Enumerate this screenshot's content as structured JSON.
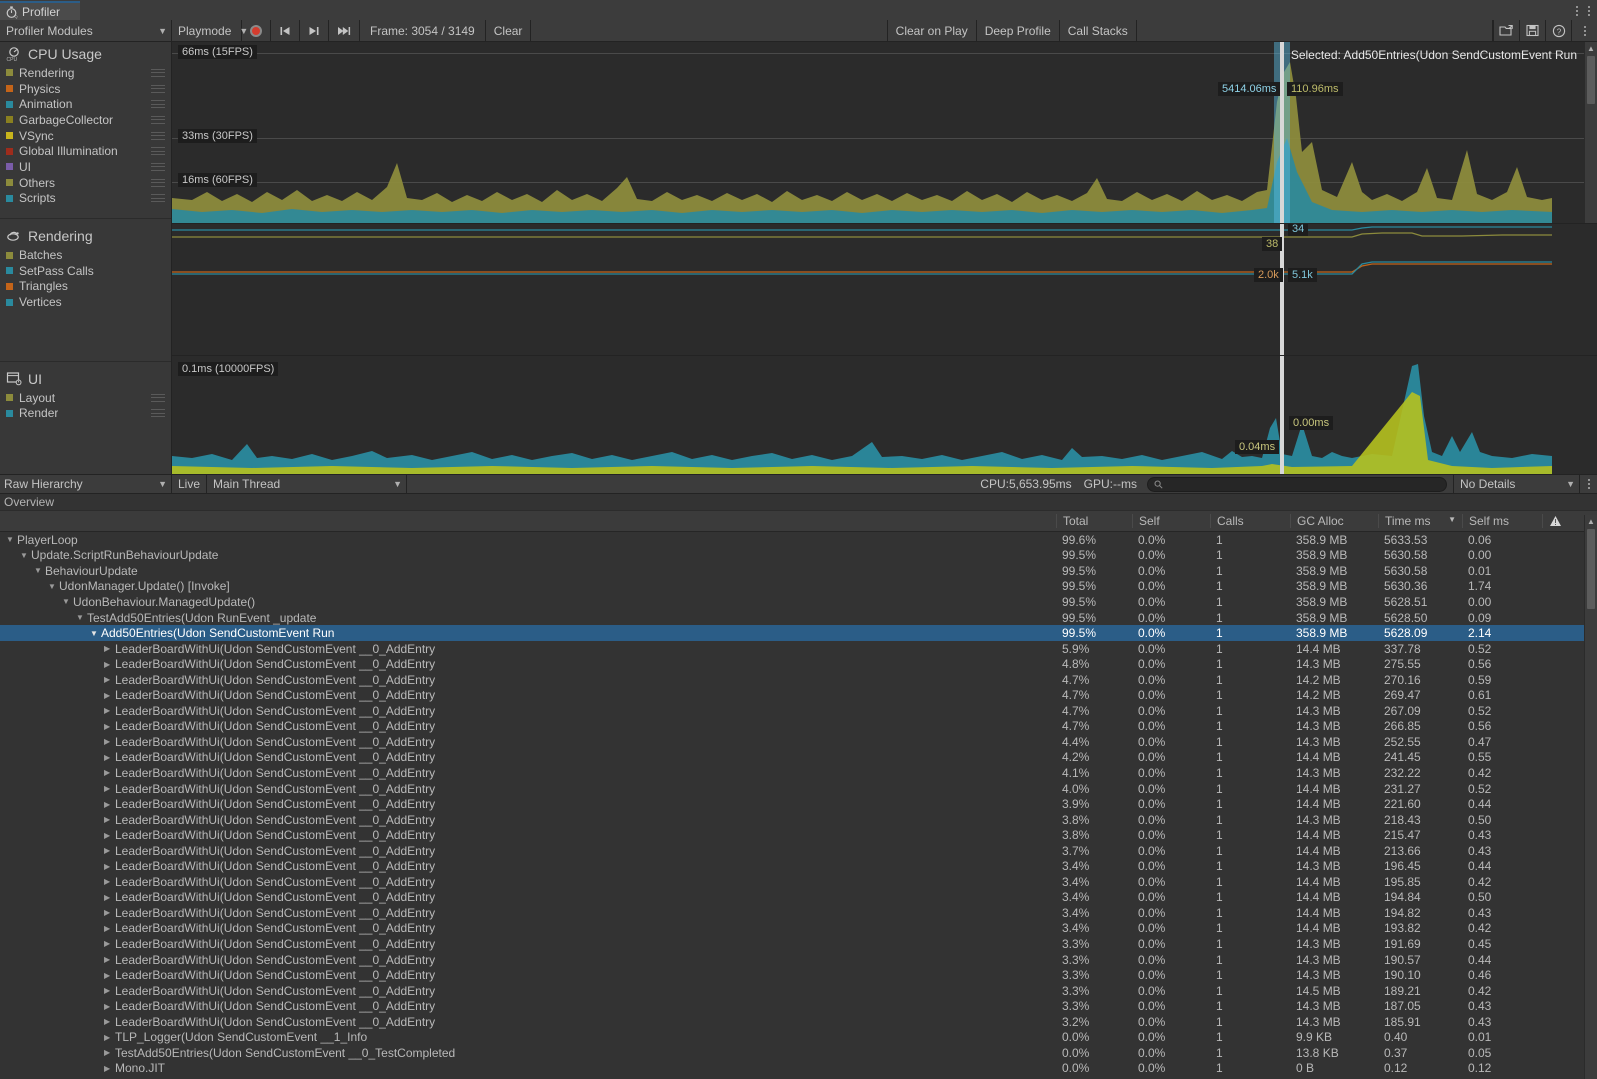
{
  "window": {
    "tab_title": "Profiler",
    "tab_icon": "stopwatch-icon",
    "kebab_icon": "kebab-menu-icon"
  },
  "toolbar": {
    "modules_label": "Profiler Modules",
    "playmode_label": "Playmode",
    "record_icon": "record-icon",
    "first_frame_icon": "skip-to-start-icon",
    "prev_frame_icon": "step-back-icon",
    "last_frame_icon": "skip-to-end-icon",
    "frame_label": "Frame: 3054 / 3149",
    "clear_label": "Clear",
    "clear_on_play_label": "Clear on Play",
    "deep_profile_label": "Deep Profile",
    "call_stacks_label": "Call Stacks",
    "load_icon": "open-folder-icon",
    "save_icon": "save-disk-icon",
    "help_icon": "help-question-icon",
    "menu_icon": "kebab-menu-icon"
  },
  "modules": [
    {
      "title": "CPU Usage",
      "icon": "cpu-icon",
      "items": [
        {
          "label": "Rendering",
          "color": "#8c8b3c"
        },
        {
          "label": "Physics",
          "color": "#c46419"
        },
        {
          "label": "Animation",
          "color": "#2a8a9e"
        },
        {
          "label": "GarbageCollector",
          "color": "#8a8020"
        },
        {
          "label": "VSync",
          "color": "#c8b41c"
        },
        {
          "label": "Global Illumination",
          "color": "#9e2c1c"
        },
        {
          "label": "UI",
          "color": "#7a5ca8"
        },
        {
          "label": "Others",
          "color": "#8c8b3c"
        },
        {
          "label": "Scripts",
          "color": "#2a8a9e"
        }
      ]
    },
    {
      "title": "Rendering",
      "icon": "rendering-icon",
      "items": [
        {
          "label": "Batches",
          "color": "#8c8b3c"
        },
        {
          "label": "SetPass Calls",
          "color": "#2a8a9e"
        },
        {
          "label": "Triangles",
          "color": "#c46419"
        },
        {
          "label": "Vertices",
          "color": "#2a8a9e"
        }
      ]
    },
    {
      "title": "UI",
      "icon": "ui-icon",
      "items": [
        {
          "label": "Layout",
          "color": "#8c8b3c"
        },
        {
          "label": "Render",
          "color": "#2a8a9e"
        }
      ]
    }
  ],
  "charts": {
    "cpu": {
      "gridlines": [
        "66ms (15FPS)",
        "33ms (30FPS)",
        "16ms (60FPS)"
      ],
      "marker_left": "5414.06ms",
      "marker_right": "110.96ms",
      "selected_text": "Selected: Add50Entries(Udon SendCustomEvent Run"
    },
    "rendering": {
      "markers": [
        "34",
        "38",
        "2.0k",
        "5.1k"
      ]
    },
    "ui": {
      "gridlines": [
        "0.1ms (10000FPS)"
      ],
      "markers": [
        "0.00ms",
        "0.04ms"
      ]
    }
  },
  "hierarchy_toolbar": {
    "view_label": "Raw Hierarchy",
    "live_label": "Live",
    "thread_label": "Main Thread",
    "cpu_stat": "CPU:5,653.95ms",
    "gpu_stat": "GPU:--ms",
    "search_placeholder": "",
    "search_value": "",
    "search_icon": "search-icon",
    "details_label": "No Details",
    "kebab_icon": "kebab-menu-icon"
  },
  "table": {
    "overview_label": "Overview",
    "columns": [
      "Total",
      "Self",
      "Calls",
      "GC Alloc",
      "Time ms",
      "Self ms"
    ],
    "warning_icon": "warning-triangle-icon",
    "sorted_column": "Time ms",
    "sort_icon": "sort-descending-icon",
    "rows": [
      {
        "depth": 0,
        "twisty": "open",
        "name": "PlayerLoop",
        "total": "99.6%",
        "self": "0.0%",
        "calls": "1",
        "gc": "358.9 MB",
        "time": "5633.53",
        "selfms": "0.06",
        "selected": false
      },
      {
        "depth": 1,
        "twisty": "open",
        "name": "Update.ScriptRunBehaviourUpdate",
        "total": "99.5%",
        "self": "0.0%",
        "calls": "1",
        "gc": "358.9 MB",
        "time": "5630.58",
        "selfms": "0.00",
        "selected": false
      },
      {
        "depth": 2,
        "twisty": "open",
        "name": "BehaviourUpdate",
        "total": "99.5%",
        "self": "0.0%",
        "calls": "1",
        "gc": "358.9 MB",
        "time": "5630.58",
        "selfms": "0.01",
        "selected": false
      },
      {
        "depth": 3,
        "twisty": "open",
        "name": "UdonManager.Update() [Invoke]",
        "total": "99.5%",
        "self": "0.0%",
        "calls": "1",
        "gc": "358.9 MB",
        "time": "5630.36",
        "selfms": "1.74",
        "selected": false
      },
      {
        "depth": 4,
        "twisty": "open",
        "name": "UdonBehaviour.ManagedUpdate()",
        "total": "99.5%",
        "self": "0.0%",
        "calls": "1",
        "gc": "358.9 MB",
        "time": "5628.51",
        "selfms": "0.00",
        "selected": false
      },
      {
        "depth": 5,
        "twisty": "open",
        "name": "TestAdd50Entries(Udon RunEvent _update",
        "total": "99.5%",
        "self": "0.0%",
        "calls": "1",
        "gc": "358.9 MB",
        "time": "5628.50",
        "selfms": "0.09",
        "selected": false
      },
      {
        "depth": 6,
        "twisty": "open",
        "name": "Add50Entries(Udon SendCustomEvent Run",
        "total": "99.5%",
        "self": "0.0%",
        "calls": "1",
        "gc": "358.9 MB",
        "time": "5628.09",
        "selfms": "2.14",
        "selected": true
      },
      {
        "depth": 7,
        "twisty": "closed",
        "name": "LeaderBoardWithUi(Udon SendCustomEvent __0_AddEntry",
        "total": "5.9%",
        "self": "0.0%",
        "calls": "1",
        "gc": "14.4 MB",
        "time": "337.78",
        "selfms": "0.52",
        "selected": false
      },
      {
        "depth": 7,
        "twisty": "closed",
        "name": "LeaderBoardWithUi(Udon SendCustomEvent __0_AddEntry",
        "total": "4.8%",
        "self": "0.0%",
        "calls": "1",
        "gc": "14.3 MB",
        "time": "275.55",
        "selfms": "0.56",
        "selected": false
      },
      {
        "depth": 7,
        "twisty": "closed",
        "name": "LeaderBoardWithUi(Udon SendCustomEvent __0_AddEntry",
        "total": "4.7%",
        "self": "0.0%",
        "calls": "1",
        "gc": "14.2 MB",
        "time": "270.16",
        "selfms": "0.59",
        "selected": false
      },
      {
        "depth": 7,
        "twisty": "closed",
        "name": "LeaderBoardWithUi(Udon SendCustomEvent __0_AddEntry",
        "total": "4.7%",
        "self": "0.0%",
        "calls": "1",
        "gc": "14.2 MB",
        "time": "269.47",
        "selfms": "0.61",
        "selected": false
      },
      {
        "depth": 7,
        "twisty": "closed",
        "name": "LeaderBoardWithUi(Udon SendCustomEvent __0_AddEntry",
        "total": "4.7%",
        "self": "0.0%",
        "calls": "1",
        "gc": "14.3 MB",
        "time": "267.09",
        "selfms": "0.52",
        "selected": false
      },
      {
        "depth": 7,
        "twisty": "closed",
        "name": "LeaderBoardWithUi(Udon SendCustomEvent __0_AddEntry",
        "total": "4.7%",
        "self": "0.0%",
        "calls": "1",
        "gc": "14.3 MB",
        "time": "266.85",
        "selfms": "0.56",
        "selected": false
      },
      {
        "depth": 7,
        "twisty": "closed",
        "name": "LeaderBoardWithUi(Udon SendCustomEvent __0_AddEntry",
        "total": "4.4%",
        "self": "0.0%",
        "calls": "1",
        "gc": "14.3 MB",
        "time": "252.55",
        "selfms": "0.47",
        "selected": false
      },
      {
        "depth": 7,
        "twisty": "closed",
        "name": "LeaderBoardWithUi(Udon SendCustomEvent __0_AddEntry",
        "total": "4.2%",
        "self": "0.0%",
        "calls": "1",
        "gc": "14.4 MB",
        "time": "241.45",
        "selfms": "0.55",
        "selected": false
      },
      {
        "depth": 7,
        "twisty": "closed",
        "name": "LeaderBoardWithUi(Udon SendCustomEvent __0_AddEntry",
        "total": "4.1%",
        "self": "0.0%",
        "calls": "1",
        "gc": "14.3 MB",
        "time": "232.22",
        "selfms": "0.42",
        "selected": false
      },
      {
        "depth": 7,
        "twisty": "closed",
        "name": "LeaderBoardWithUi(Udon SendCustomEvent __0_AddEntry",
        "total": "4.0%",
        "self": "0.0%",
        "calls": "1",
        "gc": "14.4 MB",
        "time": "231.27",
        "selfms": "0.52",
        "selected": false
      },
      {
        "depth": 7,
        "twisty": "closed",
        "name": "LeaderBoardWithUi(Udon SendCustomEvent __0_AddEntry",
        "total": "3.9%",
        "self": "0.0%",
        "calls": "1",
        "gc": "14.4 MB",
        "time": "221.60",
        "selfms": "0.44",
        "selected": false
      },
      {
        "depth": 7,
        "twisty": "closed",
        "name": "LeaderBoardWithUi(Udon SendCustomEvent __0_AddEntry",
        "total": "3.8%",
        "self": "0.0%",
        "calls": "1",
        "gc": "14.3 MB",
        "time": "218.43",
        "selfms": "0.50",
        "selected": false
      },
      {
        "depth": 7,
        "twisty": "closed",
        "name": "LeaderBoardWithUi(Udon SendCustomEvent __0_AddEntry",
        "total": "3.8%",
        "self": "0.0%",
        "calls": "1",
        "gc": "14.4 MB",
        "time": "215.47",
        "selfms": "0.43",
        "selected": false
      },
      {
        "depth": 7,
        "twisty": "closed",
        "name": "LeaderBoardWithUi(Udon SendCustomEvent __0_AddEntry",
        "total": "3.7%",
        "self": "0.0%",
        "calls": "1",
        "gc": "14.4 MB",
        "time": "213.66",
        "selfms": "0.43",
        "selected": false
      },
      {
        "depth": 7,
        "twisty": "closed",
        "name": "LeaderBoardWithUi(Udon SendCustomEvent __0_AddEntry",
        "total": "3.4%",
        "self": "0.0%",
        "calls": "1",
        "gc": "14.3 MB",
        "time": "196.45",
        "selfms": "0.44",
        "selected": false
      },
      {
        "depth": 7,
        "twisty": "closed",
        "name": "LeaderBoardWithUi(Udon SendCustomEvent __0_AddEntry",
        "total": "3.4%",
        "self": "0.0%",
        "calls": "1",
        "gc": "14.4 MB",
        "time": "195.85",
        "selfms": "0.42",
        "selected": false
      },
      {
        "depth": 7,
        "twisty": "closed",
        "name": "LeaderBoardWithUi(Udon SendCustomEvent __0_AddEntry",
        "total": "3.4%",
        "self": "0.0%",
        "calls": "1",
        "gc": "14.4 MB",
        "time": "194.84",
        "selfms": "0.50",
        "selected": false
      },
      {
        "depth": 7,
        "twisty": "closed",
        "name": "LeaderBoardWithUi(Udon SendCustomEvent __0_AddEntry",
        "total": "3.4%",
        "self": "0.0%",
        "calls": "1",
        "gc": "14.4 MB",
        "time": "194.82",
        "selfms": "0.43",
        "selected": false
      },
      {
        "depth": 7,
        "twisty": "closed",
        "name": "LeaderBoardWithUi(Udon SendCustomEvent __0_AddEntry",
        "total": "3.4%",
        "self": "0.0%",
        "calls": "1",
        "gc": "14.4 MB",
        "time": "193.82",
        "selfms": "0.42",
        "selected": false
      },
      {
        "depth": 7,
        "twisty": "closed",
        "name": "LeaderBoardWithUi(Udon SendCustomEvent __0_AddEntry",
        "total": "3.3%",
        "self": "0.0%",
        "calls": "1",
        "gc": "14.3 MB",
        "time": "191.69",
        "selfms": "0.45",
        "selected": false
      },
      {
        "depth": 7,
        "twisty": "closed",
        "name": "LeaderBoardWithUi(Udon SendCustomEvent __0_AddEntry",
        "total": "3.3%",
        "self": "0.0%",
        "calls": "1",
        "gc": "14.3 MB",
        "time": "190.57",
        "selfms": "0.44",
        "selected": false
      },
      {
        "depth": 7,
        "twisty": "closed",
        "name": "LeaderBoardWithUi(Udon SendCustomEvent __0_AddEntry",
        "total": "3.3%",
        "self": "0.0%",
        "calls": "1",
        "gc": "14.3 MB",
        "time": "190.10",
        "selfms": "0.46",
        "selected": false
      },
      {
        "depth": 7,
        "twisty": "closed",
        "name": "LeaderBoardWithUi(Udon SendCustomEvent __0_AddEntry",
        "total": "3.3%",
        "self": "0.0%",
        "calls": "1",
        "gc": "14.5 MB",
        "time": "189.21",
        "selfms": "0.42",
        "selected": false
      },
      {
        "depth": 7,
        "twisty": "closed",
        "name": "LeaderBoardWithUi(Udon SendCustomEvent __0_AddEntry",
        "total": "3.3%",
        "self": "0.0%",
        "calls": "1",
        "gc": "14.3 MB",
        "time": "187.05",
        "selfms": "0.43",
        "selected": false
      },
      {
        "depth": 7,
        "twisty": "closed",
        "name": "LeaderBoardWithUi(Udon SendCustomEvent __0_AddEntry",
        "total": "3.2%",
        "self": "0.0%",
        "calls": "1",
        "gc": "14.3 MB",
        "time": "185.91",
        "selfms": "0.43",
        "selected": false
      },
      {
        "depth": 7,
        "twisty": "closed",
        "name": "TLP_Logger(Udon SendCustomEvent __1_Info",
        "total": "0.0%",
        "self": "0.0%",
        "calls": "1",
        "gc": "9.9 KB",
        "time": "0.40",
        "selfms": "0.01",
        "selected": false
      },
      {
        "depth": 7,
        "twisty": "closed",
        "name": "TestAdd50Entries(Udon SendCustomEvent __0_TestCompleted",
        "total": "0.0%",
        "self": "0.0%",
        "calls": "1",
        "gc": "13.8 KB",
        "time": "0.37",
        "selfms": "0.05",
        "selected": false
      },
      {
        "depth": 7,
        "twisty": "closed",
        "name": "Mono.JIT",
        "total": "0.0%",
        "self": "0.0%",
        "calls": "1",
        "gc": "0 B",
        "time": "0.12",
        "selfms": "0.12",
        "selected": false
      }
    ]
  },
  "chart_data": {
    "type": "area",
    "title": "CPU Usage",
    "xlabel": "",
    "ylabel": "ms",
    "grid": true,
    "legend_position": "left-sidebar",
    "panes": [
      {
        "name": "CPU Usage",
        "gridline_labels": [
          "66ms (15FPS)",
          "33ms (30FPS)",
          "16ms (60FPS)"
        ],
        "gridline_values": [
          66,
          33,
          16
        ],
        "selected_frame_value_ms": 5414.06,
        "secondary_value_ms": 110.96,
        "series": [
          {
            "name": "Rendering",
            "color": "#8c8b3c"
          },
          {
            "name": "Physics",
            "color": "#c46419"
          },
          {
            "name": "Animation",
            "color": "#2a8a9e"
          },
          {
            "name": "GarbageCollector",
            "color": "#8a8020"
          },
          {
            "name": "VSync",
            "color": "#c8b41c"
          },
          {
            "name": "Global Illumination",
            "color": "#9e2c1c"
          },
          {
            "name": "UI",
            "color": "#7a5ca8"
          },
          {
            "name": "Others",
            "color": "#8c8b3c"
          },
          {
            "name": "Scripts",
            "color": "#2a8a9e"
          }
        ]
      },
      {
        "name": "Rendering",
        "gridline_labels": [],
        "marker_values": {
          "SetPass Calls": 34,
          "Batches": 38,
          "Triangles": "2.0k",
          "Vertices": "5.1k"
        },
        "series": [
          {
            "name": "Batches",
            "color": "#8c8b3c"
          },
          {
            "name": "SetPass Calls",
            "color": "#2a8a9e"
          },
          {
            "name": "Triangles",
            "color": "#c46419"
          },
          {
            "name": "Vertices",
            "color": "#2a8a9e"
          }
        ]
      },
      {
        "name": "UI",
        "gridline_labels": [
          "0.1ms (10000FPS)"
        ],
        "marker_values": {
          "Render": "0.00ms",
          "Layout": "0.04ms"
        },
        "series": [
          {
            "name": "Layout",
            "color": "#8c8b3c"
          },
          {
            "name": "Render",
            "color": "#2a8a9e"
          }
        ]
      }
    ]
  }
}
